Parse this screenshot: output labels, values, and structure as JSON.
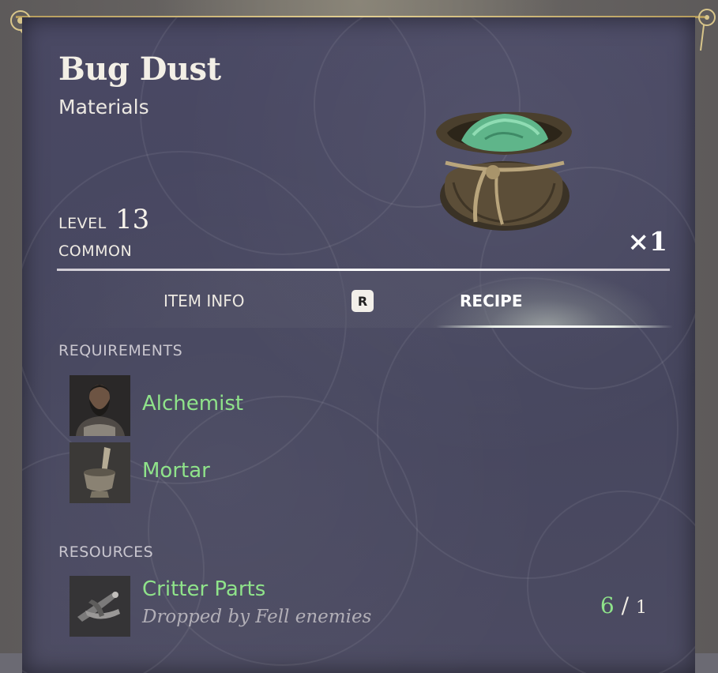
{
  "item": {
    "name": "Bug Dust",
    "category": "Materials",
    "level_label": "LEVEL",
    "level": "13",
    "rarity": "COMMON",
    "quantity": "×1",
    "icon": "bug-dust-pouch-icon"
  },
  "tabs": {
    "item_info": "ITEM INFO",
    "switch_key": "R",
    "recipe": "RECIPE",
    "active": "recipe"
  },
  "requirements": {
    "heading": "REQUIREMENTS",
    "items": [
      {
        "name": "Alchemist",
        "icon": "alchemist-portrait-icon"
      },
      {
        "name": "Mortar",
        "icon": "mortar-icon"
      }
    ]
  },
  "resources": {
    "heading": "RESOURCES",
    "items": [
      {
        "name": "Critter Parts",
        "source": "Dropped by Fell enemies",
        "have": "6",
        "separator": "/",
        "need": "1",
        "icon": "critter-parts-icon"
      }
    ]
  },
  "colors": {
    "panel": "#48485f",
    "accent_green": "#8fe38a",
    "gold_trim": "#d8c58a"
  }
}
